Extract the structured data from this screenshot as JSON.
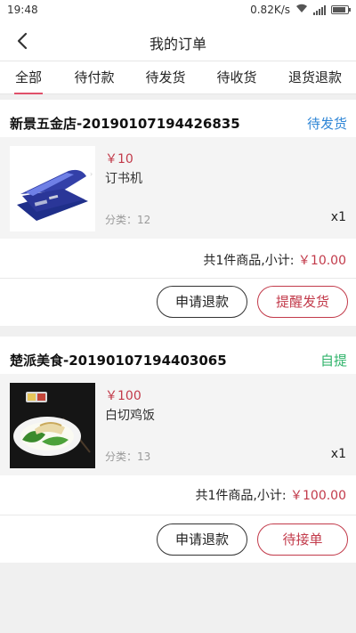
{
  "status_bar": {
    "time": "19:48",
    "net_speed": "0.82K/s",
    "battery_level": 0.9
  },
  "header": {
    "title": "我的订单"
  },
  "tabs": [
    {
      "label": "全部",
      "active": true
    },
    {
      "label": "待付款",
      "active": false
    },
    {
      "label": "待发货",
      "active": false
    },
    {
      "label": "待收货",
      "active": false
    },
    {
      "label": "退货退款",
      "active": false
    }
  ],
  "colors": {
    "accent": "#c23a4a",
    "tab_underline": "#e0506a",
    "status_blue": "#2f86d6",
    "status_green": "#2fb36a"
  },
  "orders": [
    {
      "shop": "新景五金店-20190107194426835",
      "status": "待发货",
      "status_color": "#2f86d6",
      "item": {
        "price": "￥10",
        "name": "订书机",
        "category": "分类：12",
        "qty": "x1",
        "image_icon": "stapler-image"
      },
      "summary_prefix": "共1件商品,小计: ",
      "summary_amount": "￥10.00",
      "buttons": [
        "申请退款",
        "提醒发货"
      ]
    },
    {
      "shop": "楚派美食-20190107194403065",
      "status": "自提",
      "status_color": "#2fb36a",
      "item": {
        "price": "￥100",
        "name": "白切鸡饭",
        "category": "分类：13",
        "qty": "x1",
        "image_icon": "chicken-rice-image"
      },
      "summary_prefix": "共1件商品,小计: ",
      "summary_amount": "￥100.00",
      "buttons": [
        "申请退款",
        "待接单"
      ]
    }
  ]
}
